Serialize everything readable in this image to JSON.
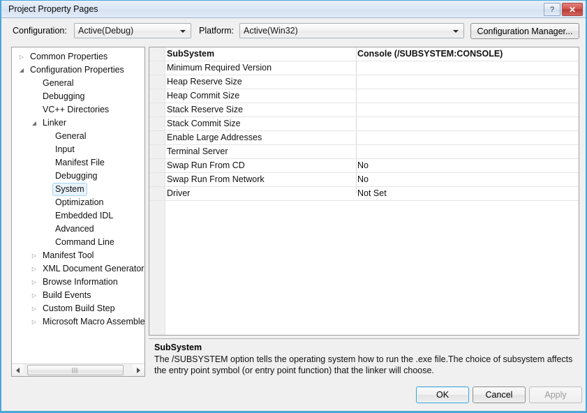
{
  "window": {
    "title": "Project Property Pages",
    "help_button": "?",
    "close_button": "✕"
  },
  "toolbar": {
    "configuration_label": "Configuration:",
    "configuration_value": "Active(Debug)",
    "platform_label": "Platform:",
    "platform_value": "Active(Win32)",
    "configuration_manager_label": "Configuration Manager..."
  },
  "tree": {
    "items": [
      {
        "label": "Common Properties",
        "indent": 0,
        "state": "collapsed",
        "selected": false
      },
      {
        "label": "Configuration Properties",
        "indent": 0,
        "state": "expanded",
        "selected": false
      },
      {
        "label": "General",
        "indent": 1,
        "state": "leaf",
        "selected": false
      },
      {
        "label": "Debugging",
        "indent": 1,
        "state": "leaf",
        "selected": false
      },
      {
        "label": "VC++ Directories",
        "indent": 1,
        "state": "leaf",
        "selected": false
      },
      {
        "label": "Linker",
        "indent": 1,
        "state": "expanded",
        "selected": false
      },
      {
        "label": "General",
        "indent": 2,
        "state": "leaf",
        "selected": false
      },
      {
        "label": "Input",
        "indent": 2,
        "state": "leaf",
        "selected": false
      },
      {
        "label": "Manifest File",
        "indent": 2,
        "state": "leaf",
        "selected": false
      },
      {
        "label": "Debugging",
        "indent": 2,
        "state": "leaf",
        "selected": false
      },
      {
        "label": "System",
        "indent": 2,
        "state": "leaf",
        "selected": true
      },
      {
        "label": "Optimization",
        "indent": 2,
        "state": "leaf",
        "selected": false
      },
      {
        "label": "Embedded IDL",
        "indent": 2,
        "state": "leaf",
        "selected": false
      },
      {
        "label": "Advanced",
        "indent": 2,
        "state": "leaf",
        "selected": false
      },
      {
        "label": "Command Line",
        "indent": 2,
        "state": "leaf",
        "selected": false
      },
      {
        "label": "Manifest Tool",
        "indent": 1,
        "state": "collapsed",
        "selected": false
      },
      {
        "label": "XML Document Generator",
        "indent": 1,
        "state": "collapsed",
        "selected": false
      },
      {
        "label": "Browse Information",
        "indent": 1,
        "state": "collapsed",
        "selected": false
      },
      {
        "label": "Build Events",
        "indent": 1,
        "state": "collapsed",
        "selected": false
      },
      {
        "label": "Custom Build Step",
        "indent": 1,
        "state": "collapsed",
        "selected": false
      },
      {
        "label": "Microsoft Macro Assembler",
        "indent": 1,
        "state": "collapsed",
        "selected": false
      }
    ],
    "scrollbar": {
      "left_arrow": "◄",
      "right_arrow": "►"
    }
  },
  "property_grid": {
    "rows": [
      {
        "name": "SubSystem",
        "value": "Console (/SUBSYSTEM:CONSOLE)",
        "active": true
      },
      {
        "name": "Minimum Required Version",
        "value": "",
        "active": false
      },
      {
        "name": "Heap Reserve Size",
        "value": "",
        "active": false
      },
      {
        "name": "Heap Commit Size",
        "value": "",
        "active": false
      },
      {
        "name": "Stack Reserve Size",
        "value": "",
        "active": false
      },
      {
        "name": "Stack Commit Size",
        "value": "",
        "active": false
      },
      {
        "name": "Enable Large Addresses",
        "value": "",
        "active": false
      },
      {
        "name": "Terminal Server",
        "value": "",
        "active": false
      },
      {
        "name": "Swap Run From CD",
        "value": "No",
        "active": false
      },
      {
        "name": "Swap Run From Network",
        "value": "No",
        "active": false
      },
      {
        "name": "Driver",
        "value": "Not Set",
        "active": false
      }
    ]
  },
  "description": {
    "title": "SubSystem",
    "body": "The /SUBSYSTEM option tells the operating system how to run the .exe file.The choice of subsystem affects the entry point symbol (or entry point function) that the linker will choose."
  },
  "footer": {
    "ok_label": "OK",
    "cancel_label": "Cancel",
    "apply_label": "Apply"
  },
  "colors": {
    "dialog_background": "#f0f0f0",
    "titlebar_accent": "#dde7f5",
    "window_border": "#4aa7d8",
    "selection_fill": "#e8f3fd",
    "selection_border": "#a8d4f0",
    "close_button": "#c2433c"
  }
}
